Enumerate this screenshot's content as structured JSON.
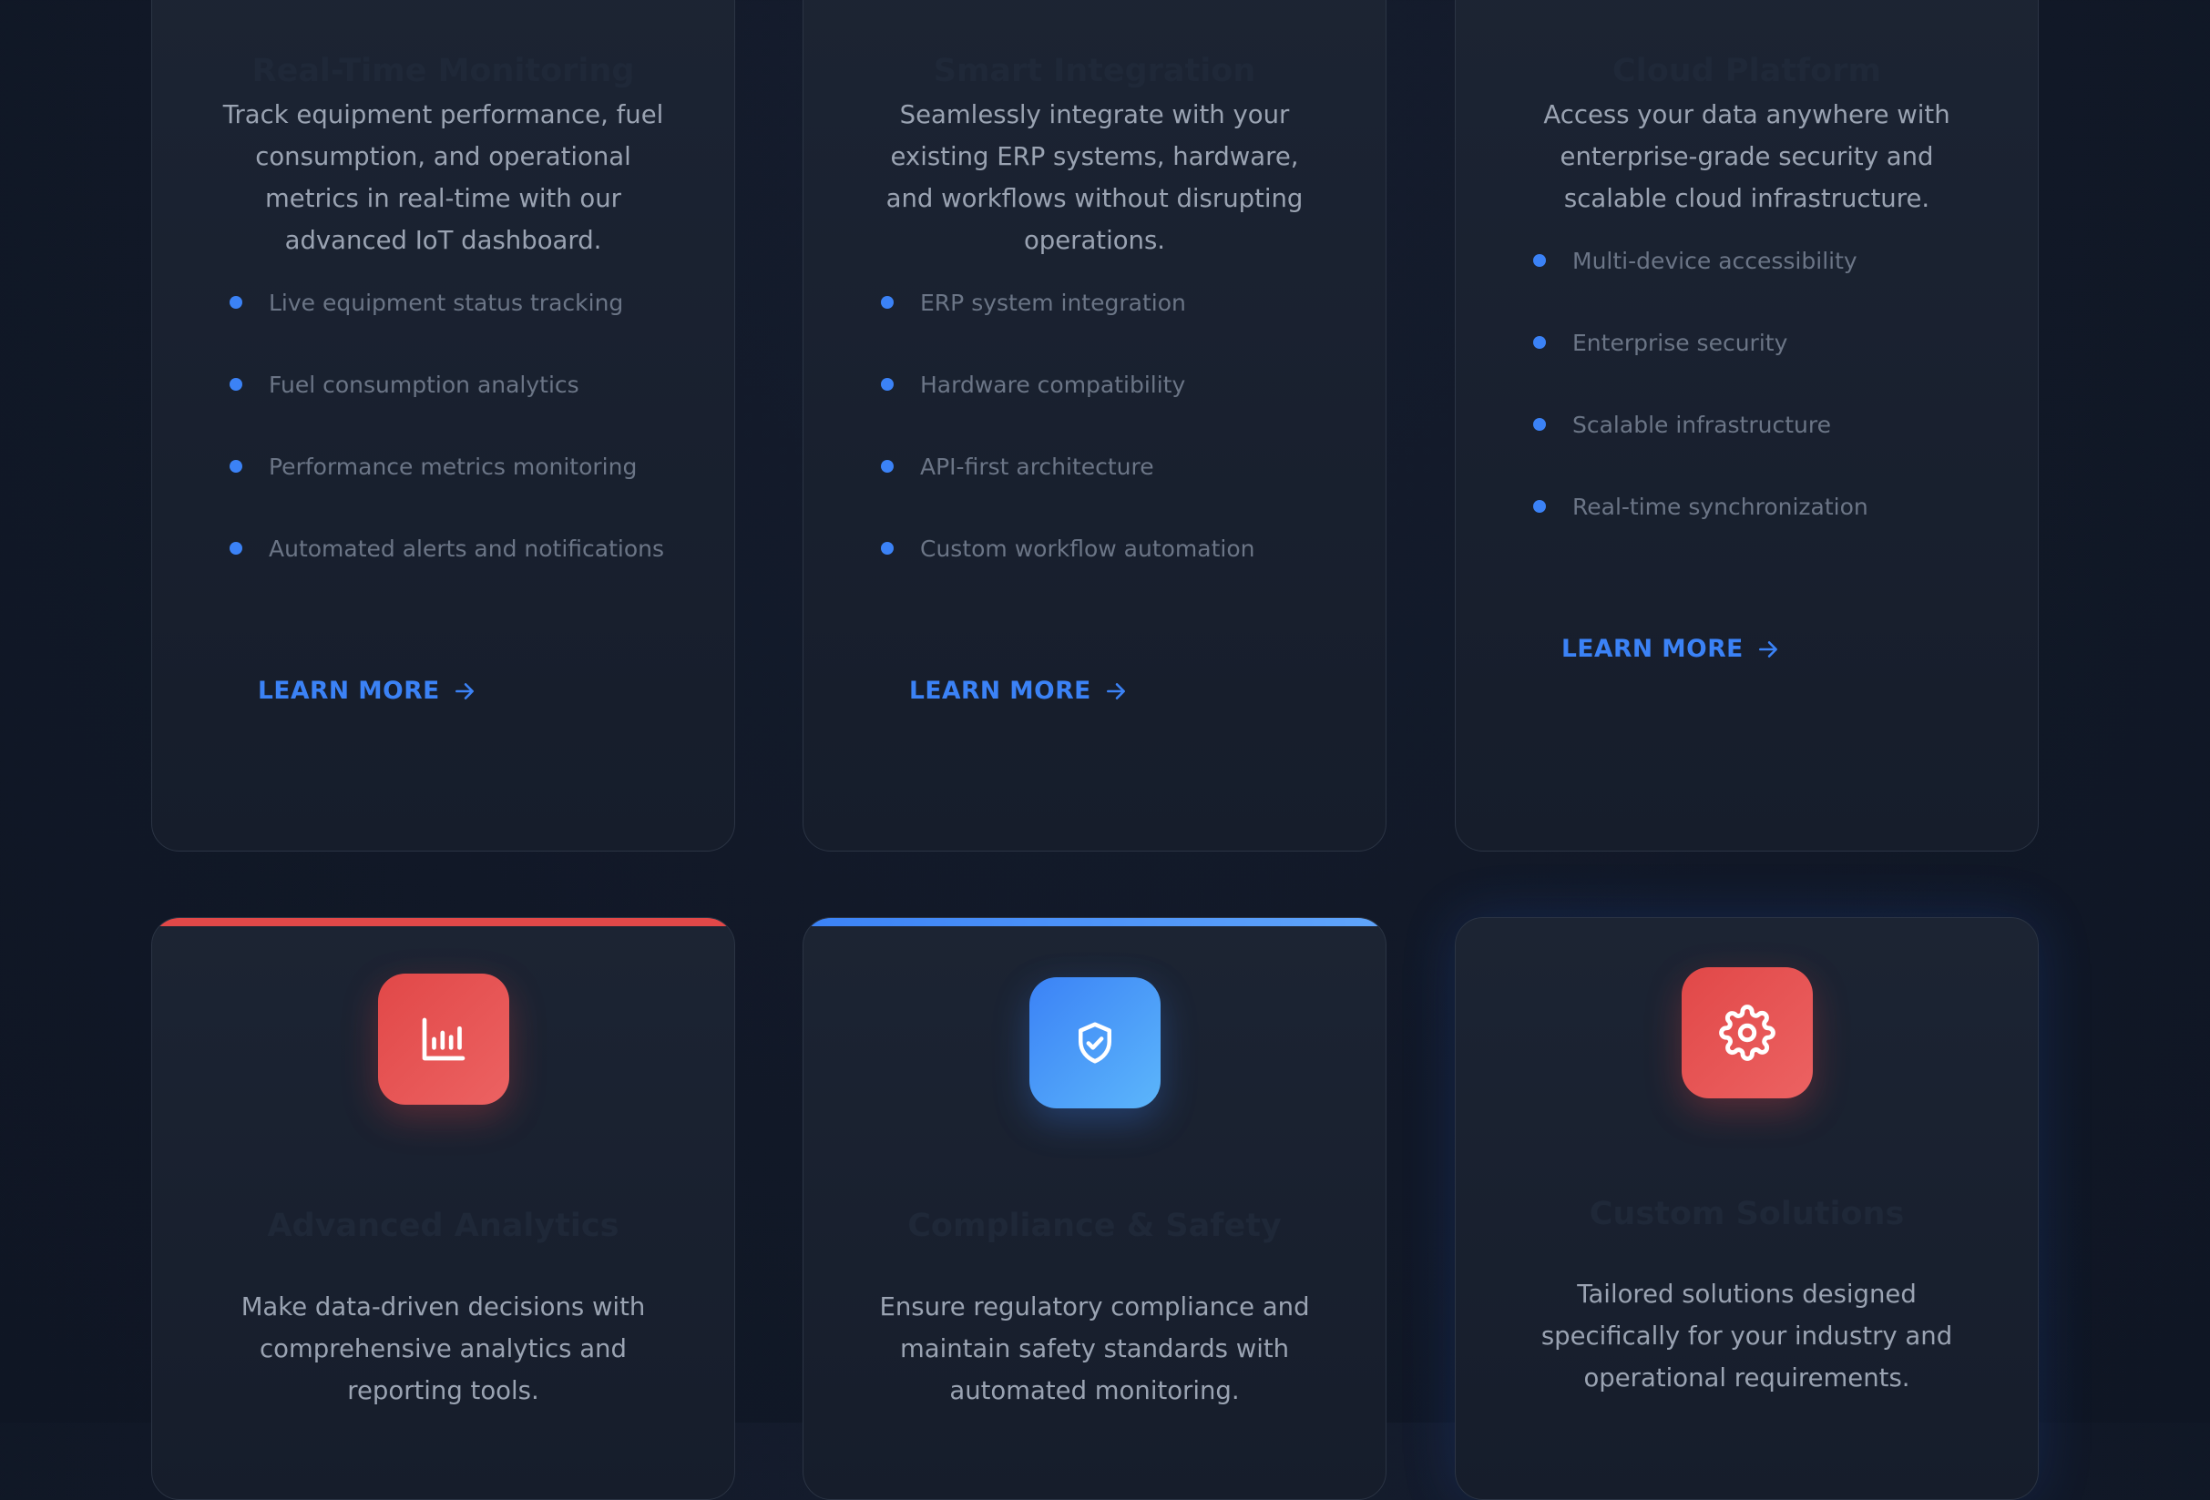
{
  "cards": [
    {
      "title": "Real-Time Monitoring",
      "description": "Track equipment performance, fuel consumption, and operational metrics in real-time with our advanced IoT dashboard.",
      "features": [
        "Live equipment status tracking",
        "Fuel consumption analytics",
        "Performance metrics monitoring",
        "Automated alerts and notifications"
      ],
      "cta": "LEARN MORE"
    },
    {
      "title": "Smart Integration",
      "description": "Seamlessly integrate with your existing ERP systems, hardware, and workflows without disrupting operations.",
      "features": [
        "ERP system integration",
        "Hardware compatibility",
        "API-first architecture",
        "Custom workflow automation"
      ],
      "cta": "LEARN MORE"
    },
    {
      "title": "Cloud Platform",
      "description": "Access your data anywhere with enterprise-grade security and scalable cloud infrastructure.",
      "features": [
        "Multi-device accessibility",
        "Enterprise security",
        "Scalable infrastructure",
        "Real-time synchronization"
      ],
      "cta": "LEARN MORE"
    },
    {
      "title": "Advanced Analytics",
      "description": "Make data-driven decisions with comprehensive analytics and reporting tools.",
      "icon": "bar-chart-icon",
      "accent": "#e14848"
    },
    {
      "title": "Compliance & Safety",
      "description": "Ensure regulatory compliance and maintain safety standards with automated monitoring.",
      "icon": "shield-check-icon",
      "accent": "#3b82f6"
    },
    {
      "title": "Custom Solutions",
      "description": "Tailored solutions designed specifically for your industry and operational requirements.",
      "icon": "gear-icon",
      "accent": "#e14848"
    }
  ],
  "colors": {
    "background": "#111827",
    "card_border": "#2b3444",
    "link": "#3b82f6",
    "bullet": "#3b82f6",
    "red_accent": "#e14848",
    "blue_accent": "#3b82f6"
  }
}
